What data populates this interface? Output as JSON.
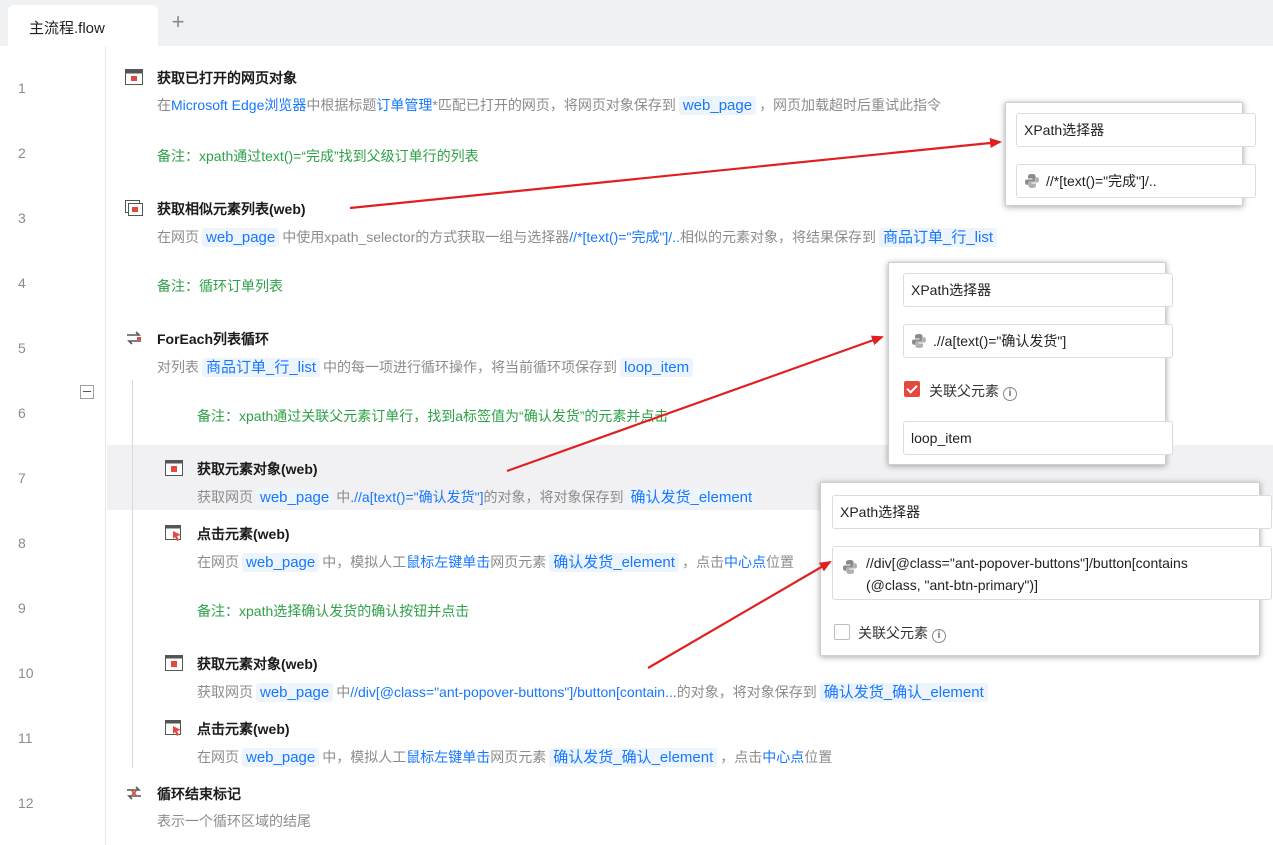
{
  "tabs": {
    "active": "主流程.flow",
    "add": "+"
  },
  "line_numbers": [
    "1",
    "2",
    "3",
    "4",
    "5",
    "6",
    "7",
    "8",
    "9",
    "10",
    "11",
    "12"
  ],
  "steps": {
    "s1": {
      "title": "获取已打开的网页对象",
      "d1": "在",
      "l1": "Microsoft Edge浏览器",
      "d2": "中根据标题",
      "l2": "订单管理",
      "d3": "*匹配已打开的网页，将网页对象保存到",
      "v1": "web_page",
      "d4": "，网页加载超时后重试此指令"
    },
    "n2": "备注：xpath通过text()=“完成”找到父级订单行的列表",
    "s3": {
      "title": "获取相似元素列表(web)",
      "d1": "在网页",
      "v1": "web_page",
      "d2": "中使用xpath_selector的方式获取一组与选择器",
      "l1": "//*[text()=\"完成\"]/..",
      "d3": "相似的元素对象，将结果保存到",
      "v2": "商品订单_行_list"
    },
    "n4": "备注：循环订单列表",
    "s5": {
      "title": "ForEach列表循环",
      "d1": "对列表",
      "v1": "商品订单_行_list",
      "d2": "中的每一项进行循环操作，将当前循环项保存到",
      "v2": "loop_item"
    },
    "n6": "备注：xpath通过关联父元素订单行，找到a标签值为“确认发货”的元素并点击",
    "s7": {
      "title": "获取元素对象(web)",
      "d1": "获取网页",
      "v1": "web_page",
      "d2": "中",
      "l1": ".//a[text()=\"确认发货\"]",
      "d3": "的对象，将对象保存到",
      "v2": "确认发货_element"
    },
    "s8": {
      "title": "点击元素(web)",
      "d1": "在网页",
      "v1": "web_page",
      "d2": "中，模拟人工",
      "l1": "鼠标左键单击",
      "d3": "网页元素",
      "v2": "确认发货_element",
      "d4": "，点击",
      "l2": "中心点",
      "d5": "位置"
    },
    "n9": "备注：xpath选择确认发货的确认按钮并点击",
    "s10": {
      "title": "获取元素对象(web)",
      "d1": "获取网页",
      "v1": "web_page",
      "d2": "中",
      "l1": "//div[@class=\"ant-popover-buttons\"]/button[contain...",
      "d3": "的对象，将对象保存到",
      "v2": "确认发货_确认_element"
    },
    "s11": {
      "title": "点击元素(web)",
      "d1": "在网页",
      "v1": "web_page",
      "d2": "中，模拟人工",
      "l1": "鼠标左键单击",
      "d3": "网页元素",
      "v2": "确认发货_确认_element",
      "d4": "，点击",
      "l2": "中心点",
      "d5": "位置"
    },
    "s12": {
      "title": "循环结束标记",
      "desc": "表示一个循环区域的结尾"
    }
  },
  "popups": {
    "p1": {
      "selector_type": "XPath选择器",
      "xpath": "//*[text()=\"完成\"]/.."
    },
    "p2": {
      "selector_type": "XPath选择器",
      "xpath": ".//a[text()=\"确认发货\"]",
      "checkbox_label": "关联父元素",
      "checked": true,
      "parent": "loop_item"
    },
    "p3": {
      "selector_type": "XPath选择器",
      "xpath_line1": "//div[@class=\"ant-popover-buttons\"]/button[contains",
      "xpath_line2": "(@class, \"ant-btn-primary\")]",
      "checkbox_label": "关联父元素",
      "checked": false
    }
  },
  "colors": {
    "link": "#1677ff",
    "note": "#2ea148",
    "arrow": "#e02020",
    "checkbox": "#e5483c"
  }
}
